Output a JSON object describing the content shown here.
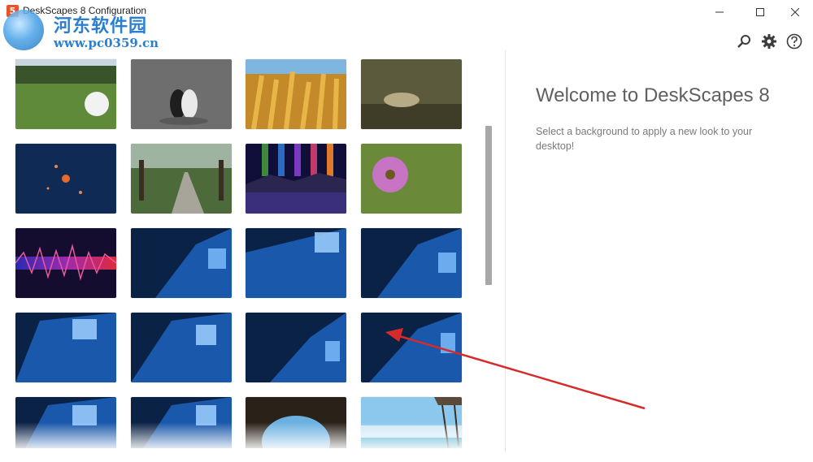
{
  "window": {
    "title": "DeskScapes 8 Configuration",
    "app_icon": "5"
  },
  "watermark": {
    "cn_text": "河东软件园",
    "url": "www.pc0359.cn"
  },
  "toolbar": {
    "icons": [
      "search-icon",
      "gear-icon",
      "help-icon"
    ]
  },
  "gallery": {
    "thumbnails": [
      "golf-ball-on-grass",
      "black-and-white-cats",
      "golden-wheat-field",
      "dry-leaf-on-ground",
      "blue-space-planets",
      "tree-lined-road",
      "aurora-mountain-lake",
      "pink-daisy-flower",
      "audio-waveform-spectrum",
      "windows-10-blue",
      "windows-10-blue",
      "windows-10-blue",
      "windows-10-blue",
      "windows-10-blue",
      "windows-10-blue",
      "windows-10-blue",
      "windows-10-blue",
      "windows-10-blue",
      "sea-cave-beach",
      "tropical-beach-pier"
    ]
  },
  "panel": {
    "title": "Welcome to DeskScapes 8",
    "description": "Select a background to apply a new look to your desktop!"
  },
  "colors": {
    "annotation_arrow": "#d62b2b",
    "panel_title": "#606060",
    "scrollbar": "#a8a8a8"
  }
}
